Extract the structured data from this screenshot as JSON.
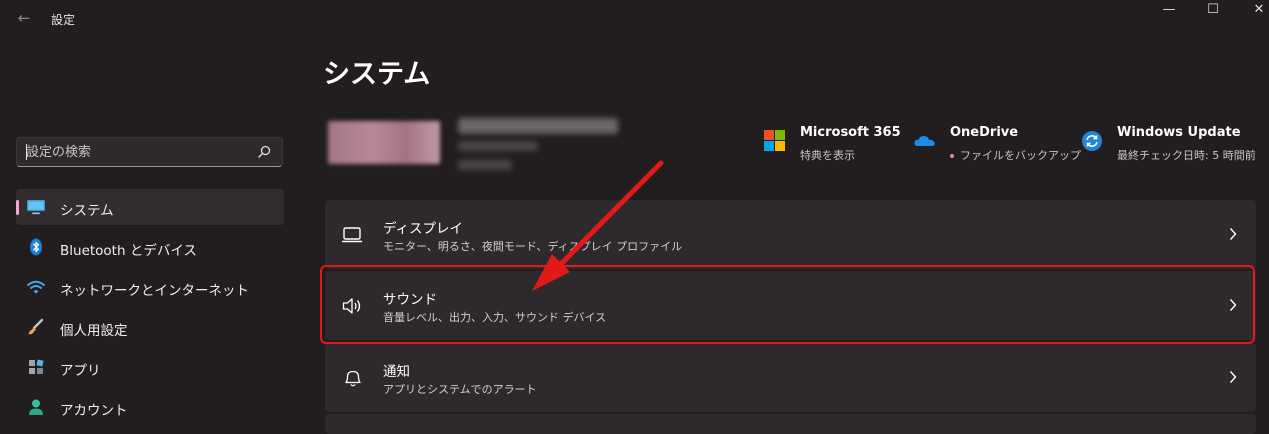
{
  "window": {
    "title": "設定",
    "back_icon": "←",
    "minimize_icon": "—",
    "maximize_icon": "☐",
    "close_icon": "✕"
  },
  "search": {
    "placeholder": "設定の検索"
  },
  "sidebar": {
    "items": [
      {
        "label": "システム",
        "icon": "monitor-icon",
        "active": true
      },
      {
        "label": "Bluetooth とデバイス",
        "icon": "bluetooth-icon",
        "active": false
      },
      {
        "label": "ネットワークとインターネット",
        "icon": "wifi-icon",
        "active": false
      },
      {
        "label": "個人用設定",
        "icon": "brush-icon",
        "active": false
      },
      {
        "label": "アプリ",
        "icon": "apps-icon",
        "active": false
      },
      {
        "label": "アカウント",
        "icon": "person-icon",
        "active": false
      }
    ]
  },
  "main": {
    "title": "システム",
    "quick_links": [
      {
        "title": "Microsoft 365",
        "subtitle": "特典を表示",
        "icon": "microsoft-logo-icon"
      },
      {
        "title": "OneDrive",
        "subtitle": "ファイルをバックアップ",
        "icon": "onedrive-cloud-icon"
      },
      {
        "title": "Windows Update",
        "subtitle": "最終チェック日時: 5 時間前",
        "icon": "windows-update-icon"
      }
    ],
    "cards": [
      {
        "title": "ディスプレイ",
        "subtitle": "モニター、明るさ、夜間モード、ディスプレイ プロファイル",
        "icon": "display-icon"
      },
      {
        "title": "サウンド",
        "subtitle": "音量レベル、出力、入力、サウンド デバイス",
        "icon": "speaker-icon"
      },
      {
        "title": "通知",
        "subtitle": "アプリとシステムでのアラート",
        "icon": "bell-icon"
      }
    ]
  },
  "colors": {
    "background": "#221d1f",
    "card": "#2e292c",
    "accent": "#f0aacd",
    "highlight": "#e01a1a"
  }
}
